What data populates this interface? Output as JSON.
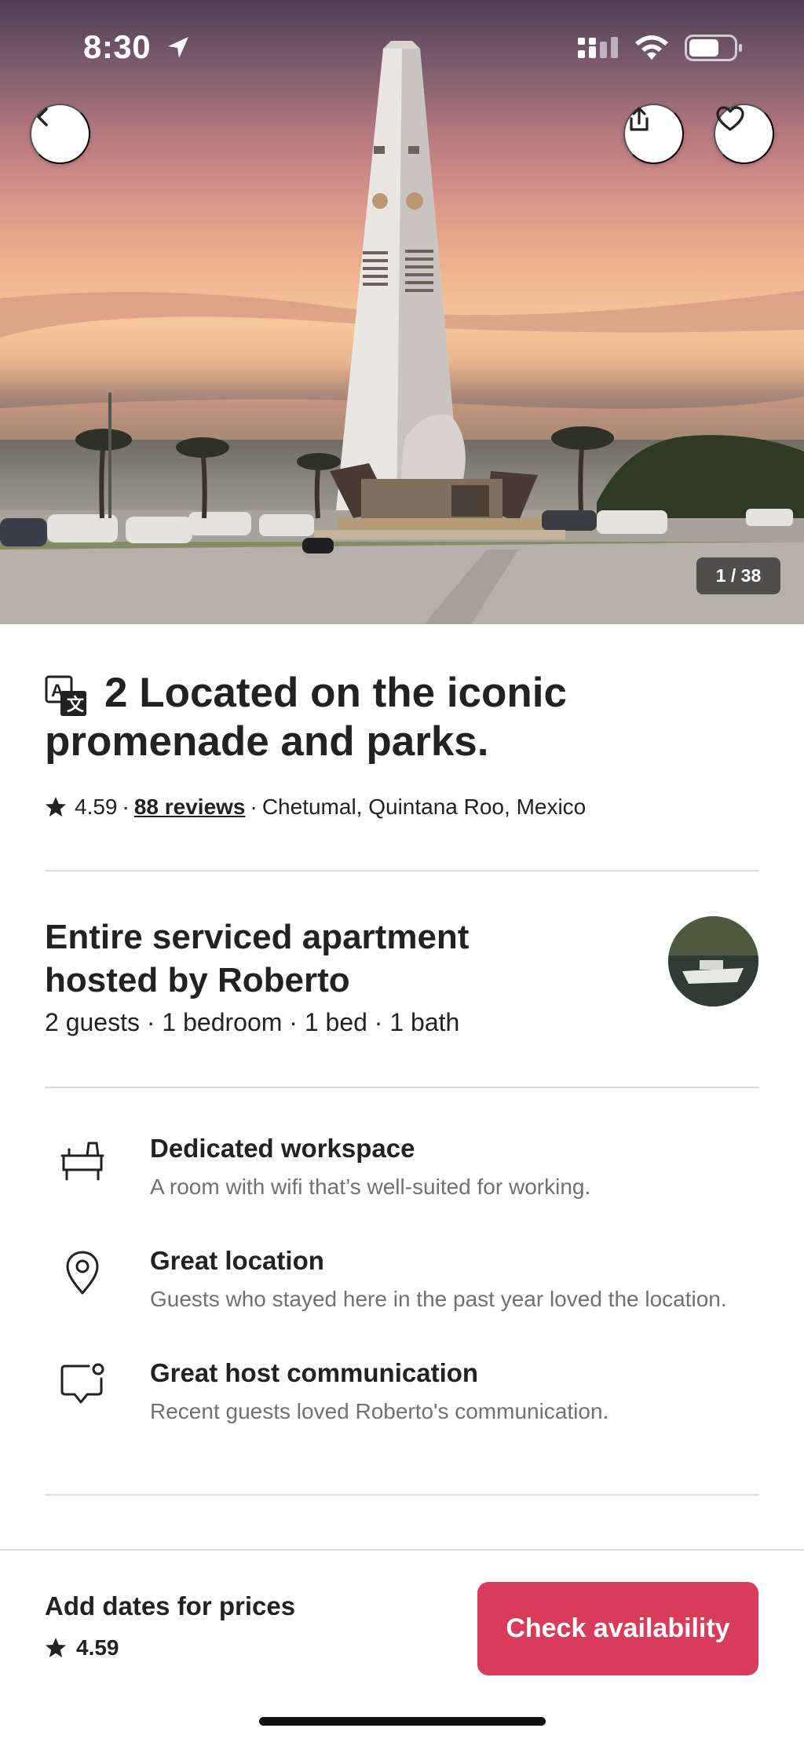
{
  "status_bar": {
    "time": "8:30"
  },
  "hero": {
    "photo_counter": "1 / 38"
  },
  "listing": {
    "title": "2 Located on the iconic promenade and parks.",
    "rating": "4.59",
    "rating_sep": "·",
    "reviews_link": "88 reviews",
    "location": "Chetumal, Quintana Roo, Mexico"
  },
  "host": {
    "title": "Entire serviced apartment hosted by Roberto",
    "details": "2 guests · 1 bedroom · 1 bed · 1 bath"
  },
  "features": [
    {
      "icon": "desk-icon",
      "title": "Dedicated workspace",
      "description": "A room with wifi that’s well-suited for working."
    },
    {
      "icon": "location-pin-icon",
      "title": "Great location",
      "description": "Guests who stayed here in the past year loved the location."
    },
    {
      "icon": "chat-bubble-icon",
      "title": "Great host communication",
      "description": "Recent guests loved Roberto's communication."
    }
  ],
  "booking_bar": {
    "price_label": "Add dates for prices",
    "rating": "4.59",
    "cta_label": "Check availability",
    "cta_color": "#d93b5a"
  }
}
